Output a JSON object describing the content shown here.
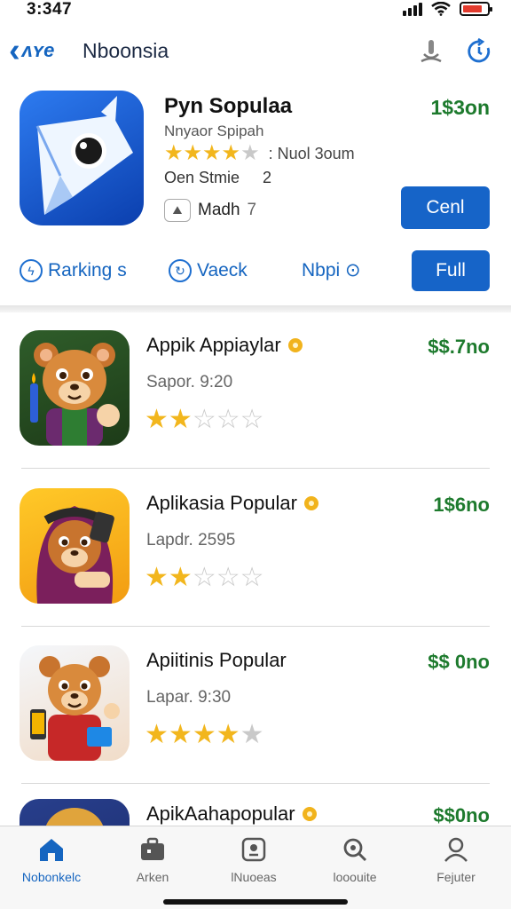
{
  "status": {
    "time": "3:347"
  },
  "nav": {
    "back_label": "ʌʏe",
    "title": "Nboonsia",
    "icons": [
      "mic-icon",
      "refresh-icon"
    ]
  },
  "featured": {
    "title": "Pyn Sopulaa",
    "subtitle": "Nnyaor Spipah",
    "rating": 4,
    "reviews": ": Nuol 3oum",
    "line3_label": "Oen Stmie",
    "line3_num": "2",
    "line4_label": "Madh",
    "line4_num": "7",
    "price": "1$3on",
    "get_label": "Cenl",
    "actions": [
      {
        "label": "Rarking s",
        "icon": "bolt-icon"
      },
      {
        "label": "Vaeck",
        "icon": "chat-refresh-icon"
      },
      {
        "label": "Nbpi ⊙",
        "icon": ""
      }
    ],
    "full_label": "Full"
  },
  "apps": [
    {
      "name": "Appik Appiaylar",
      "sub": "Sapor. 9:20",
      "price": "$$.7no",
      "rating": 2.5
    },
    {
      "name": "Aplikasia Popular",
      "sub": "Lapdr. 2595",
      "price": "1$6no",
      "rating": 2.5
    },
    {
      "name": "Apiitinis Popular",
      "sub": "Lapar. 9:30",
      "price": "$$ 0no",
      "rating": 4
    },
    {
      "name": "ApikAahapopular",
      "sub": "",
      "price": "$$0no",
      "rating": 0
    }
  ],
  "tabs": [
    {
      "label": "Nobonkelc",
      "icon": "home-icon",
      "active": true
    },
    {
      "label": "Arken",
      "icon": "briefcase-icon",
      "active": false
    },
    {
      "label": "lNuoeas",
      "icon": "badge-icon",
      "active": false
    },
    {
      "label": "looouite",
      "icon": "search-icon",
      "active": false
    },
    {
      "label": "Fejuter",
      "icon": "person-icon",
      "active": false
    }
  ],
  "colors": {
    "accent": "#1664c8",
    "price": "#1d7a2d",
    "star": "#f2b61d"
  }
}
